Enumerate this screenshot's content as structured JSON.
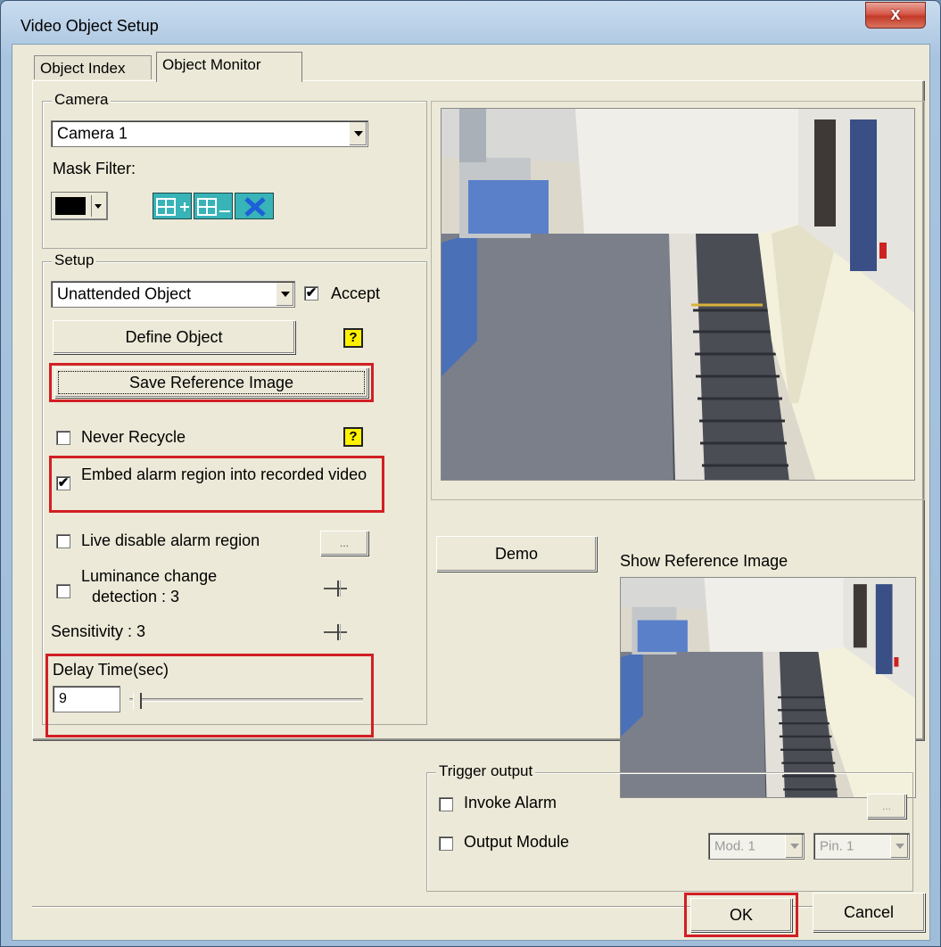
{
  "window": {
    "title": "Video Object Setup",
    "close_label": "x"
  },
  "tabs": [
    {
      "label": "Object Index"
    },
    {
      "label": "Object Monitor"
    }
  ],
  "camera": {
    "group_label": "Camera",
    "selected": "Camera 1",
    "mask_filter_label": "Mask Filter:",
    "mask_color": "#000000"
  },
  "setup": {
    "group_label": "Setup",
    "object_type": "Unattended Object",
    "accept_label": "Accept",
    "accept_checked": true,
    "define_object_label": "Define Object",
    "save_reference_label": "Save Reference Image",
    "never_recycle_label": "Never Recycle",
    "never_recycle_checked": false,
    "embed_alarm_label": "Embed alarm region into recorded video",
    "embed_alarm_checked": true,
    "live_disable_label": "Live disable alarm region",
    "live_disable_checked": false,
    "browse_label": "...",
    "luminance_label_1": "Luminance change",
    "luminance_label_2": "detection : 3",
    "luminance_checked": false,
    "sensitivity_label": "Sensitivity : 3",
    "delay_label": "Delay Time(sec)",
    "delay_value": "9",
    "help_label": "?"
  },
  "preview": {
    "demo_label": "Demo",
    "show_reference_label": "Show Reference Image"
  },
  "trigger": {
    "group_label": "Trigger output",
    "invoke_alarm_label": "Invoke Alarm",
    "invoke_alarm_checked": false,
    "output_module_label": "Output Module",
    "output_module_checked": false,
    "browse_label": "...",
    "module_value": "Mod. 1",
    "pin_value": "Pin. 1"
  },
  "footer": {
    "ok_label": "OK",
    "cancel_label": "Cancel"
  },
  "colors": {
    "highlight": "#d11f24",
    "help_icon": "#fff200"
  }
}
